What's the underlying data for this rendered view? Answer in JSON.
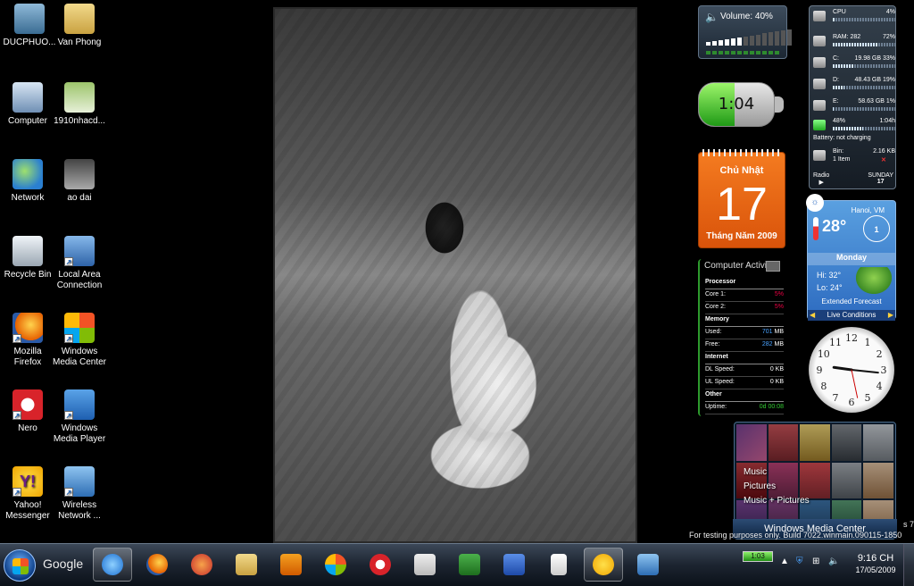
{
  "desktop": {
    "icons": [
      {
        "label": "DUCPHUO..."
      },
      {
        "label": "Van Phong"
      },
      {
        "label": "Computer"
      },
      {
        "label": "1910nhacd..."
      },
      {
        "label": "Network"
      },
      {
        "label": "ao dai"
      },
      {
        "label": "Recycle Bin"
      },
      {
        "label": "Local Area Connection"
      },
      {
        "label": "Mozilla Firefox"
      },
      {
        "label": "Windows Media Center"
      },
      {
        "label": "Nero"
      },
      {
        "label": "Windows Media Player"
      },
      {
        "label": "Yahoo! Messenger"
      },
      {
        "label": "Wireless Network ..."
      }
    ]
  },
  "gadgets": {
    "volume": {
      "label": "Volume: 40%",
      "level": 0.4
    },
    "battery": {
      "time": "1:04",
      "level": 0.48
    },
    "calendar": {
      "day_of_week": "Chủ Nhật",
      "day": "17",
      "month_year": "Tháng Năm 2009"
    },
    "activity": {
      "title": "Computer Activity",
      "sections": {
        "processor": "Processor",
        "core1_label": "Core 1:",
        "core1": "5%",
        "core2_label": "Core 2:",
        "core2": "5%",
        "memory": "Memory",
        "used_label": "Used:",
        "used": "701",
        "used_unit": "MB",
        "free_label": "Free:",
        "free": "282",
        "free_unit": "MB",
        "internet": "Internet",
        "dl_label": "DL Speed:",
        "dl": "0 KB",
        "ul_label": "UL Speed:",
        "ul": "0 KB",
        "other": "Other",
        "uptime_label": "Uptime:",
        "uptime": "0d 00:08"
      }
    },
    "sysmon": {
      "cpu_label": "CPU",
      "cpu": "4%",
      "cpu_level": 0.04,
      "ram_label": "RAM: 282",
      "ram": "72%",
      "ram_level": 0.72,
      "c_label": "C:",
      "c": "19.98 GB 33%",
      "c_level": 0.33,
      "d_label": "D:",
      "d": "48.43 GB 19%",
      "d_level": 0.19,
      "e_label": "E:",
      "e": "58.63 GB 1%",
      "e_level": 0.01,
      "batt": "48%",
      "batt_time": "1:04h",
      "batt_level": 0.48,
      "batt_status": "Battery: not charging",
      "bin_label": "Bin:",
      "bin_size": "2.16 KB",
      "bin_items": "1 Item",
      "radio": "Radio",
      "weekday": "SUNDAY",
      "date": "17"
    },
    "weather": {
      "city": "Hanoi, VM",
      "temp": "28°",
      "wind": "1",
      "day": "Monday",
      "hi": "Hi: 32°",
      "lo": "Lo: 24°",
      "extended": "Extended Forecast",
      "live": "Live Conditions"
    },
    "clock": {
      "numerals": [
        "12",
        "1",
        "2",
        "3",
        "4",
        "5",
        "6",
        "7",
        "8",
        "9",
        "10",
        "11"
      ],
      "hour": 9,
      "minute": 16,
      "second": 28
    },
    "media_center": {
      "items": [
        "Music",
        "Pictures",
        "Music + Pictures"
      ],
      "bar_label": "Windows Media Center"
    }
  },
  "watermark": "For testing purposes only. Build 7022.winmain.090115-1850",
  "winver": "s 7",
  "taskbar": {
    "google": "Google",
    "buttons": [
      "Internet Explorer",
      "Firefox",
      "Yahoo Messenger",
      "Explorer",
      "Media Player",
      "Media Center",
      "Nero",
      "Unikey",
      "Excel",
      "Word",
      "Solitaire",
      "Yahoo",
      "Remote Desktop"
    ],
    "tray": {
      "battery": "1:03",
      "time": "9:16 CH",
      "date": "17/05/2009"
    }
  },
  "colors": {
    "calendar": "#f47b20",
    "weather": "#2d6bc0",
    "battery_fill": "#1f9a16"
  }
}
